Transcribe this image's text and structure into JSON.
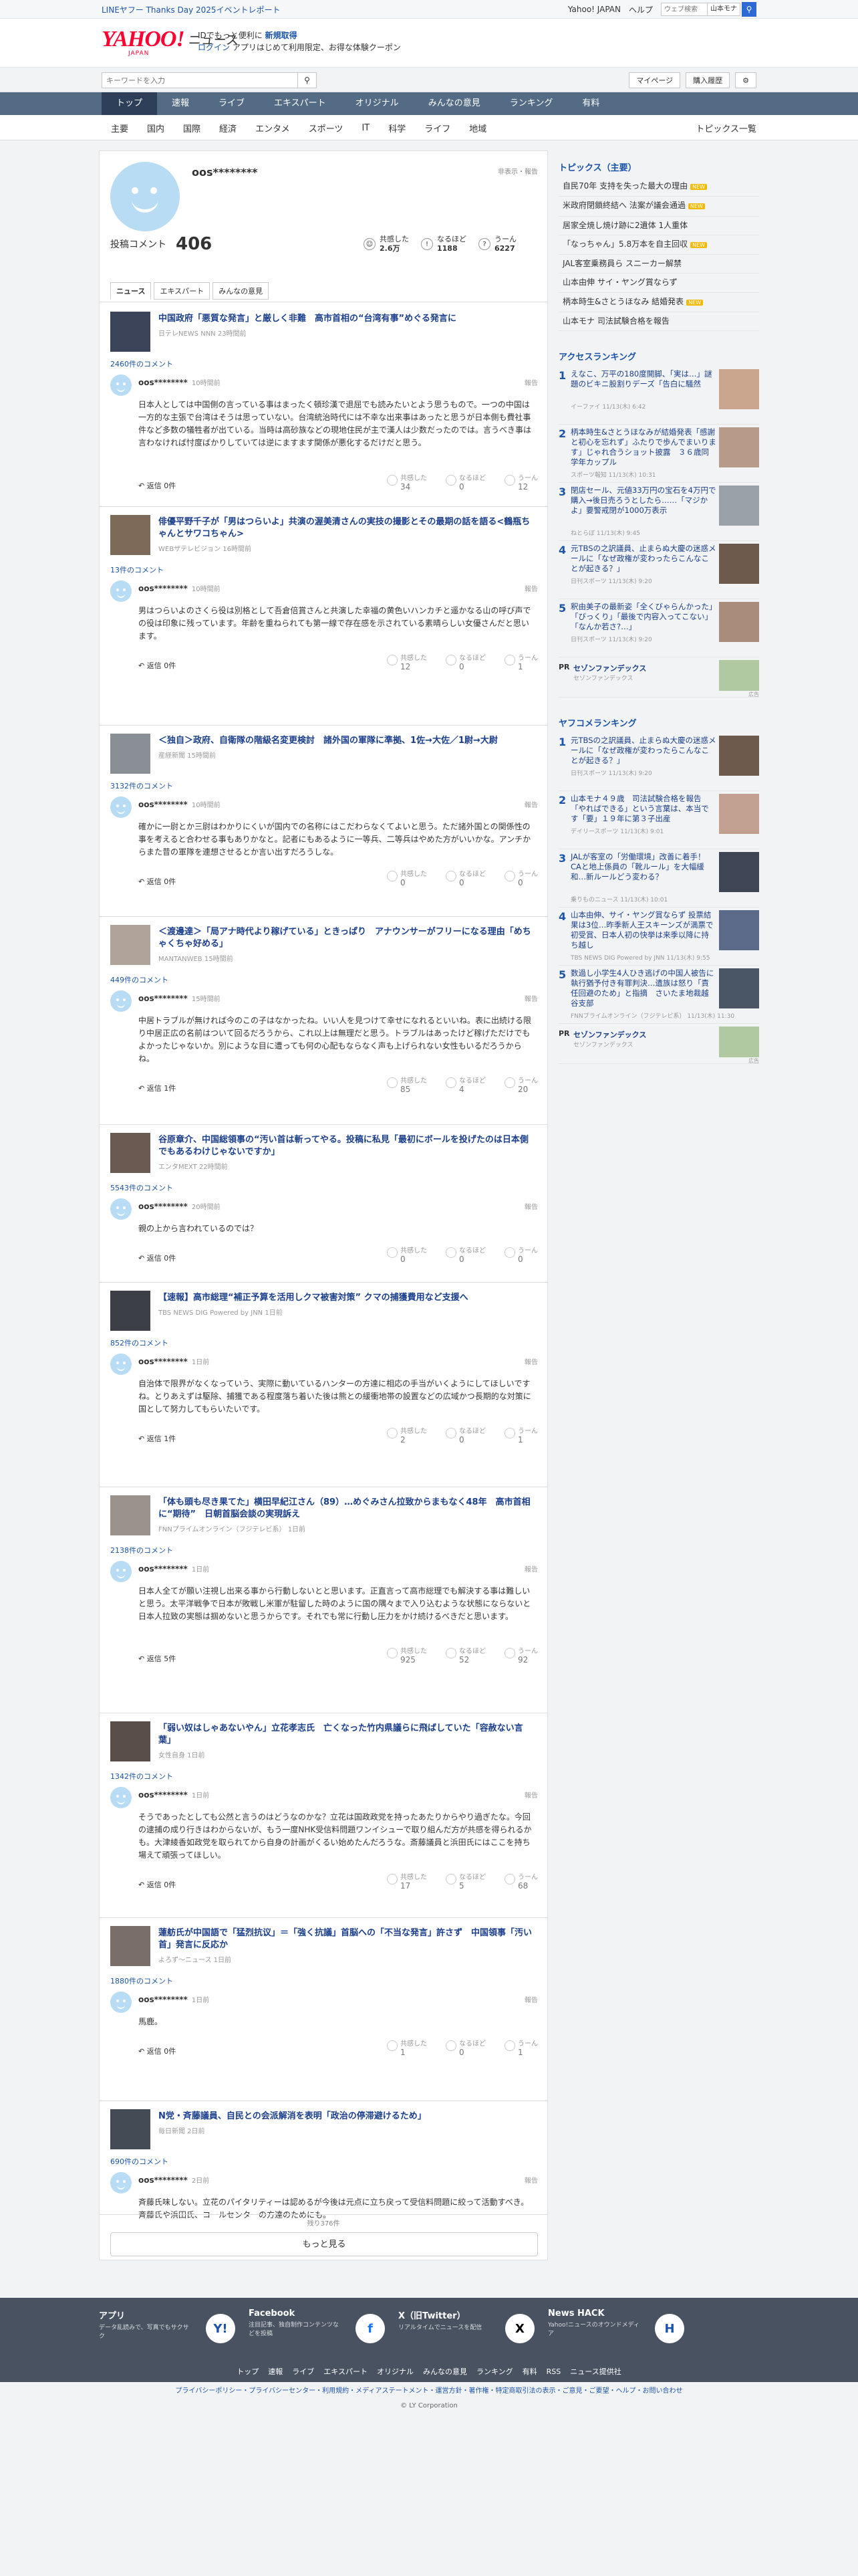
{
  "topbar": {
    "promo": "LINEヤフー Thanks Day 2025イベントレポート",
    "links": [
      "Yahoo! JAPAN",
      "ヘルプ"
    ],
    "search_placeholder": "ウェブ検索",
    "search_scope": "山本モナ"
  },
  "header": {
    "logo": "YAHOO!",
    "logo_sub": "JAPAN",
    "section": "ニュース",
    "promo_l1_a": "IDでもっと便利に",
    "promo_l1_b": "新規取得",
    "promo_l2_a": "ログイン",
    "promo_l2_b": "アプリはじめて利用限定、お得な体験クーポン"
  },
  "subbar": {
    "search_placeholder": "キーワードを入力",
    "mypage": "マイページ",
    "history": "購入履歴"
  },
  "gnav": [
    "トップ",
    "速報",
    "ライブ",
    "エキスパート",
    "オリジナル",
    "みんなの意見",
    "ランキング",
    "有料"
  ],
  "snav": {
    "items": [
      "主要",
      "国内",
      "国際",
      "経済",
      "エンタメ",
      "スポーツ",
      "IT",
      "科学",
      "ライフ",
      "地域"
    ],
    "right": "トピックス一覧"
  },
  "profile": {
    "name": "oos********",
    "flags": "非表示・報告",
    "label": "投稿コメント",
    "count": "406",
    "kyokan_label": "共感した",
    "kyokan": "2.6万",
    "naruhodo_label": "なるほど",
    "naruhodo": "1188",
    "un_label": "うーん",
    "un": "6227",
    "tabs": [
      "ニュース",
      "エキスパート",
      "みんなの意見"
    ]
  },
  "comments": [
    {
      "title": "中国政府「悪質な発言」と厳しく非難　高市首相の“台湾有事”めぐる発言に",
      "source": "日テレNEWS NNN 23時間前",
      "ccount": "2460件のコメント",
      "user": "oos********",
      "time": "10時間前",
      "text": "日本人としては中国側の言っている事はまったく頓珍漢で退屈でも読みたいとよう思うもので。一つの中国は一方的な主張で台湾はそうは思っていない。台湾統治時代には不幸な出来事はあったと思うが日本側も費社事件など多数の犠牲者が出ている。当時は高砂族などの現地住民が主で漢人は少数だったのでは。言うべき事は言わなければ忖度ばかりしていては逆にますます関係が悪化するだけだと思う。",
      "reply": "返信 0件",
      "r": [
        "34",
        "0",
        "12"
      ]
    },
    {
      "title": "俳優平野千子が「男はつらいよ」共演の渥美清さんの実技の撮影とその最期の話を語る<鶴瓶ちゃんとサワコちゃん>",
      "source": "WEBザテレビジョン 16時間前",
      "ccount": "13件のコメント",
      "user": "oos********",
      "time": "10時間前",
      "text": "男はつらいよのさくら役は別格として吾倉倍賞さんと共演した幸福の黄色いハンカチと遥かなる山の呼び声での役は印象に残っています。年齢を重ねられても第一線で存在感を示されている素晴らしい女優さんだと思います。",
      "reply": "返信 0件",
      "r": [
        "12",
        "0",
        "1"
      ]
    },
    {
      "title": "＜独自＞政府、自衛隊の階級名変更検討　諸外国の軍隊に準拠、1佐→大佐／1尉→大尉",
      "source": "産経新聞 15時間前",
      "ccount": "3132件のコメント",
      "user": "oos********",
      "time": "10時間前",
      "text": "確かに一尉とか三尉はわかりにくいが国内での名称にはこだわらなくてよいと思う。ただ諸外国との関係性の事を考えると合わせる事もありかなと。記者にもあるように一等兵、二等兵はやめた方がいいかな。アンチからまた昔の軍隊を連想させるとか言い出すだろうしな。",
      "reply": "返信 0件",
      "r": [
        "0",
        "0",
        "0"
      ]
    },
    {
      "title": "＜渡邊達＞「局アナ時代より稼げている」ときっぱり　アナウンサーがフリーになる理由「めちゃくちゃ好める」",
      "source": "MANTANWEB 15時間前",
      "ccount": "449件のコメント",
      "user": "oos********",
      "time": "15時間前",
      "text": "中居トラブルが無ければ今のこの子はなかったね。いい人を見つけて幸せになれるといいね。表に出続ける限り中居正広の名前はついて回るだろうから、これ以上は無理だと思う。トラブルはあったけど稼げただけでもよかったじゃないか。別にような目に遭っても何の心配もならなく声も上げられない女性もいるだろうからね。",
      "reply": "返信 1件",
      "r": [
        "85",
        "4",
        "20"
      ]
    },
    {
      "title": "谷原章介、中国総領事の“汚い首は斬ってやる。投稿に私見「最初にボールを投げたのは日本側でもあるわけじゃないですか」",
      "source": "エンタMEXT 22時間前",
      "ccount": "5543件のコメント",
      "user": "oos********",
      "time": "20時間前",
      "text": "親の上から言われているのでは？",
      "reply": "返信 0件",
      "r": [
        "0",
        "0",
        "0"
      ]
    },
    {
      "title": "【速報】高市総理“補正予算を活用しクマ被害対策” クマの捕獲費用など支援へ",
      "source": "TBS NEWS DIG Powered by JNN 1日前",
      "ccount": "852件のコメント",
      "user": "oos********",
      "time": "1日前",
      "text": "自治体で限界がなくなっていう、実際に動いているハンターの方達に相応の手当がいくようにしてほしいですね。とりあえずは駆除、捕獲である程度落ち着いた後は熊との緩衝地帯の設置などの広域かつ長期的な対策に国として努力してもらいたいです。",
      "reply": "返信 1件",
      "r": [
        "2",
        "0",
        "1"
      ]
    },
    {
      "title": "「体も頭も尽き果てた」横田早紀江さん（89）…めぐみさん拉致からまもなく48年　高市首相に“期待”　日朝首脳会談の実現訴え",
      "source": "FNNプライムオンライン（フジテレビ系） 1日前",
      "ccount": "2138件のコメント",
      "user": "oos********",
      "time": "1日前",
      "text": "日本人全てが願い注視し出来る事から行動しないとと思います。正直言って高市総理でも解決する事は難しいと思う。太平洋戦争で日本が敗戦し米軍が駐留した時のように国の隅々まで入り込むような状態にならないと日本人拉致の実態は掴めないと思うからです。それでも常に行動し圧力をかけ続けるべきだと思います。",
      "reply": "返信 5件",
      "r": [
        "925",
        "52",
        "92"
      ]
    },
    {
      "title": "「弱い奴はしゃあないやん」立花孝志氏　亡くなった竹内県議らに飛ばしていた「容赦ない言葉」",
      "source": "女性自身 1日前",
      "ccount": "1342件のコメント",
      "user": "oos********",
      "time": "1日前",
      "text": "そうであったとしても公然と言うのはどうなのかな？立花は国政政党を持ったあたりからやり過ぎたな。今回の逮捕の成り行きはわからないが、もう一度NHK受信料問題ワンイシューで取り組んだ方が共感を得られるかも。大津綾香如政党を取られてから自身の計画がくるい始めたんだろうな。斎藤議員と浜田氏にはここを持ち場えて頑張ってほしい。",
      "reply": "返信 0件",
      "r": [
        "17",
        "5",
        "68"
      ]
    },
    {
      "title": "蓮舫氏が中国語で「猛烈抗议」＝「強く抗議」首脳への「不当な発言」許さず　中国領事「汚い首」発言に反応か",
      "source": "よろず～ニュース 1日前",
      "ccount": "1880件のコメント",
      "user": "oos********",
      "time": "1日前",
      "text": "馬鹿。",
      "reply": "返信 0件",
      "r": [
        "1",
        "0",
        "1"
      ]
    },
    {
      "title": "N党・斉藤議員、自民との会派解消を表明「政治の停滞避けるため」",
      "source": "毎日新聞 2日前",
      "ccount": "690件のコメント",
      "user": "oos********",
      "time": "2日前",
      "text": "斉藤氏味しない。立花のパイタリティーは認めるが今後は元点に立ち戻って受信料問題に絞って活動すべき。斉藤氏や浜田氏、コールセンターの方達のためにも。",
      "reply": "返信 0件",
      "r": [
        "2",
        "0",
        "0"
      ]
    }
  ],
  "reaction_labels": [
    "共感した",
    "なるほど",
    "うーん"
  ],
  "report": "報告",
  "more": {
    "remaining": "残り376件",
    "button": "もっと見る"
  },
  "sidebar": {
    "topics_title": "トピックス（主要）",
    "topics": [
      {
        "t": "自民70年 支持を失った最大の理由",
        "tag": "NEW"
      },
      {
        "t": "米政府閉鎖終結へ 法案が議会通過",
        "tag": "NEW"
      },
      {
        "t": "居家全焼し焼け跡に2遺体 1人重体",
        "tag": ""
      },
      {
        "t": "「なっちゃん」5.8万本を自主回収",
        "tag": "NEW"
      },
      {
        "t": "JAL客室乗務員ら スニーカー解禁",
        "tag": ""
      },
      {
        "t": "山本由伸 サイ・ヤング賞ならず",
        "tag": ""
      },
      {
        "t": "柄本時生&さとうほなみ 結婚発表",
        "tag": "NEW"
      },
      {
        "t": "山本モナ 司法試験合格を報告",
        "tag": ""
      }
    ],
    "access_title": "アクセスランキング",
    "access": [
      {
        "n": "1",
        "t": "えなこ、万平の180度開脚、「実は…」謎題のビキニ股割りデーズ「告白に騒然",
        "s": "イーファイ 11/13(木) 6:42"
      },
      {
        "n": "2",
        "t": "柄本時生&さとうほなみが結婚発表「感謝と初心を忘れず」ふたりで歩んでまいります」じゃれ合うショット披露　３６歳同学年カップル",
        "s": "スポーツ報知 11/13(木) 10:31"
      },
      {
        "n": "3",
        "t": "閉店セール、元値33万円の宝石を4万円で購入→後日売ろうとしたら……「マジかよ」要警戒閉が1000万表示",
        "s": "ねとらぼ 11/13(木) 9:45"
      },
      {
        "n": "4",
        "t": "元TBSの之訳議員、止まらぬ大慶の迷惑メールに「なぜ政権が変わったらこんなことが起きる？」",
        "s": "日刊スポーツ 11/13(木) 9:20"
      },
      {
        "n": "5",
        "t": "釈由美子の最新姿「全くびゃらんかった」「びっくり」「最後で内容入ってこない」「なんか若さ?…」",
        "s": "日刊スポーツ 11/13(木) 9:20"
      }
    ],
    "pr1": {
      "label": "PR",
      "title": "セゾンファンデックス",
      "sub": "セゾンファンデックス",
      "ad": "広告"
    },
    "yafuko_title": "ヤフコメランキング",
    "yafuko": [
      {
        "n": "1",
        "t": "元TBSの之訳議員、止まらぬ大慶の迷惑メールに「なぜ政権が変わったらこんなことが起きる？」",
        "s": "日刊スポーツ 11/13(木) 9:20"
      },
      {
        "n": "2",
        "t": "山本モナ４９歳　司法試験合格を報告「やればできる」という言葉は、本当です「要」１９年に第３子出産",
        "s": "デイリースポーツ 11/13(木) 9:01"
      },
      {
        "n": "3",
        "t": "JALが客室の「労働環境」改善に着手！ CAと地上係員の「靴ルール」を大幅緩和…新ルールどう変わる？",
        "s": "乗りものニュース 11/13(木) 10:01"
      },
      {
        "n": "4",
        "t": "山本由伸、サイ・ヤング賞ならず 投票結果は3位…昨季新人王スキーンズが満票で初受賞、日本人初の快挙は来季以降に持ち越し",
        "s": "TBS NEWS DIG Powered by JNN 11/13(木) 9:55"
      },
      {
        "n": "5",
        "t": "数過し小学生4人ひき逃げの中国人被告に執行猶予付き有罪判決…遺族は怒り「責任回避のため」と指摘　さいたま地裁越谷支部",
        "s": "FNNプライムオンライン（フジテレビ系） 11/13(木) 11:30"
      }
    ],
    "pr2": {
      "label": "PR",
      "title": "セゾンファンデックス",
      "sub": "セゾンファンデックス",
      "ad": "広告"
    }
  },
  "footer": {
    "sns": [
      {
        "h": "アプリ",
        "d": "データ乱読みで、写真でもサクサク",
        "ic": "Y!"
      },
      {
        "h": "Facebook",
        "d": "注目記事、独自制作コンテンツなどを投稿",
        "ic": "f"
      },
      {
        "h": "X（旧Twitter）",
        "d": "リアルタイムでニュースを配信",
        "ic": "X"
      },
      {
        "h": "News HACK",
        "d": "Yahoo!ニュースのオウンドメディア",
        "ic": "H"
      }
    ],
    "links": [
      "トップ",
      "速報",
      "ライブ",
      "エキスパート",
      "オリジナル",
      "みんなの意見",
      "ランキング",
      "有料",
      "RSS",
      "ニュース提供社"
    ],
    "legal": "プライバシーポリシー・プライバシーセンター・利用規約・メディアステートメント・運営方針・著作権・特定商取引法の表示・ご意見・ご要望・ヘルプ・お問い合わせ",
    "copyright": "© LY Corporation"
  }
}
